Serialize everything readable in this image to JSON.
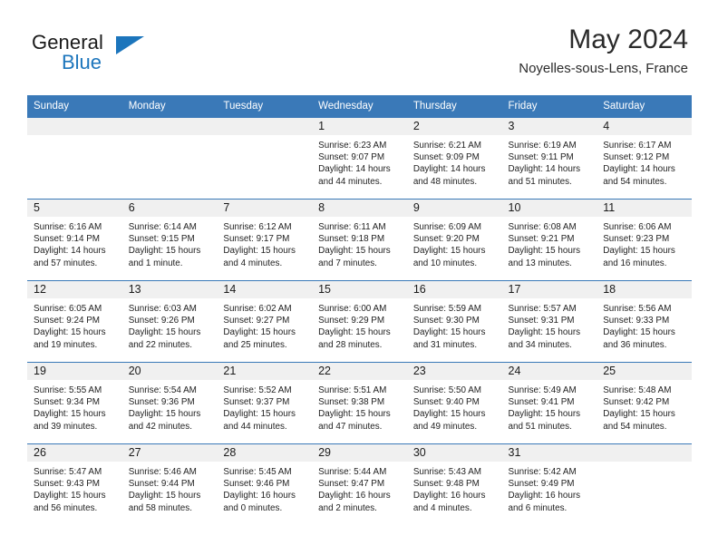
{
  "brand": {
    "name_part1": "General",
    "name_part2": "Blue",
    "logo_icon": "triangle-logo-icon",
    "accent_color": "#1c75bc"
  },
  "header": {
    "month_title": "May 2024",
    "location": "Noyelles-sous-Lens, France"
  },
  "theme": {
    "header_row_color": "#3a79b8",
    "day_band_color": "#f0f0f0",
    "text_color": "#222222"
  },
  "calendar": {
    "weekday_headers": [
      "Sunday",
      "Monday",
      "Tuesday",
      "Wednesday",
      "Thursday",
      "Friday",
      "Saturday"
    ],
    "labels": {
      "sunrise": "Sunrise:",
      "sunset": "Sunset:",
      "daylight": "Daylight:"
    },
    "weeks": [
      [
        {
          "day": "",
          "empty": true
        },
        {
          "day": "",
          "empty": true
        },
        {
          "day": "",
          "empty": true
        },
        {
          "day": "1",
          "sunrise": "Sunrise: 6:23 AM",
          "sunset": "Sunset: 9:07 PM",
          "daylight_line1": "Daylight: 14 hours",
          "daylight_line2": "and 44 minutes."
        },
        {
          "day": "2",
          "sunrise": "Sunrise: 6:21 AM",
          "sunset": "Sunset: 9:09 PM",
          "daylight_line1": "Daylight: 14 hours",
          "daylight_line2": "and 48 minutes."
        },
        {
          "day": "3",
          "sunrise": "Sunrise: 6:19 AM",
          "sunset": "Sunset: 9:11 PM",
          "daylight_line1": "Daylight: 14 hours",
          "daylight_line2": "and 51 minutes."
        },
        {
          "day": "4",
          "sunrise": "Sunrise: 6:17 AM",
          "sunset": "Sunset: 9:12 PM",
          "daylight_line1": "Daylight: 14 hours",
          "daylight_line2": "and 54 minutes."
        }
      ],
      [
        {
          "day": "5",
          "sunrise": "Sunrise: 6:16 AM",
          "sunset": "Sunset: 9:14 PM",
          "daylight_line1": "Daylight: 14 hours",
          "daylight_line2": "and 57 minutes."
        },
        {
          "day": "6",
          "sunrise": "Sunrise: 6:14 AM",
          "sunset": "Sunset: 9:15 PM",
          "daylight_line1": "Daylight: 15 hours",
          "daylight_line2": "and 1 minute."
        },
        {
          "day": "7",
          "sunrise": "Sunrise: 6:12 AM",
          "sunset": "Sunset: 9:17 PM",
          "daylight_line1": "Daylight: 15 hours",
          "daylight_line2": "and 4 minutes."
        },
        {
          "day": "8",
          "sunrise": "Sunrise: 6:11 AM",
          "sunset": "Sunset: 9:18 PM",
          "daylight_line1": "Daylight: 15 hours",
          "daylight_line2": "and 7 minutes."
        },
        {
          "day": "9",
          "sunrise": "Sunrise: 6:09 AM",
          "sunset": "Sunset: 9:20 PM",
          "daylight_line1": "Daylight: 15 hours",
          "daylight_line2": "and 10 minutes."
        },
        {
          "day": "10",
          "sunrise": "Sunrise: 6:08 AM",
          "sunset": "Sunset: 9:21 PM",
          "daylight_line1": "Daylight: 15 hours",
          "daylight_line2": "and 13 minutes."
        },
        {
          "day": "11",
          "sunrise": "Sunrise: 6:06 AM",
          "sunset": "Sunset: 9:23 PM",
          "daylight_line1": "Daylight: 15 hours",
          "daylight_line2": "and 16 minutes."
        }
      ],
      [
        {
          "day": "12",
          "sunrise": "Sunrise: 6:05 AM",
          "sunset": "Sunset: 9:24 PM",
          "daylight_line1": "Daylight: 15 hours",
          "daylight_line2": "and 19 minutes."
        },
        {
          "day": "13",
          "sunrise": "Sunrise: 6:03 AM",
          "sunset": "Sunset: 9:26 PM",
          "daylight_line1": "Daylight: 15 hours",
          "daylight_line2": "and 22 minutes."
        },
        {
          "day": "14",
          "sunrise": "Sunrise: 6:02 AM",
          "sunset": "Sunset: 9:27 PM",
          "daylight_line1": "Daylight: 15 hours",
          "daylight_line2": "and 25 minutes."
        },
        {
          "day": "15",
          "sunrise": "Sunrise: 6:00 AM",
          "sunset": "Sunset: 9:29 PM",
          "daylight_line1": "Daylight: 15 hours",
          "daylight_line2": "and 28 minutes."
        },
        {
          "day": "16",
          "sunrise": "Sunrise: 5:59 AM",
          "sunset": "Sunset: 9:30 PM",
          "daylight_line1": "Daylight: 15 hours",
          "daylight_line2": "and 31 minutes."
        },
        {
          "day": "17",
          "sunrise": "Sunrise: 5:57 AM",
          "sunset": "Sunset: 9:31 PM",
          "daylight_line1": "Daylight: 15 hours",
          "daylight_line2": "and 34 minutes."
        },
        {
          "day": "18",
          "sunrise": "Sunrise: 5:56 AM",
          "sunset": "Sunset: 9:33 PM",
          "daylight_line1": "Daylight: 15 hours",
          "daylight_line2": "and 36 minutes."
        }
      ],
      [
        {
          "day": "19",
          "sunrise": "Sunrise: 5:55 AM",
          "sunset": "Sunset: 9:34 PM",
          "daylight_line1": "Daylight: 15 hours",
          "daylight_line2": "and 39 minutes."
        },
        {
          "day": "20",
          "sunrise": "Sunrise: 5:54 AM",
          "sunset": "Sunset: 9:36 PM",
          "daylight_line1": "Daylight: 15 hours",
          "daylight_line2": "and 42 minutes."
        },
        {
          "day": "21",
          "sunrise": "Sunrise: 5:52 AM",
          "sunset": "Sunset: 9:37 PM",
          "daylight_line1": "Daylight: 15 hours",
          "daylight_line2": "and 44 minutes."
        },
        {
          "day": "22",
          "sunrise": "Sunrise: 5:51 AM",
          "sunset": "Sunset: 9:38 PM",
          "daylight_line1": "Daylight: 15 hours",
          "daylight_line2": "and 47 minutes."
        },
        {
          "day": "23",
          "sunrise": "Sunrise: 5:50 AM",
          "sunset": "Sunset: 9:40 PM",
          "daylight_line1": "Daylight: 15 hours",
          "daylight_line2": "and 49 minutes."
        },
        {
          "day": "24",
          "sunrise": "Sunrise: 5:49 AM",
          "sunset": "Sunset: 9:41 PM",
          "daylight_line1": "Daylight: 15 hours",
          "daylight_line2": "and 51 minutes."
        },
        {
          "day": "25",
          "sunrise": "Sunrise: 5:48 AM",
          "sunset": "Sunset: 9:42 PM",
          "daylight_line1": "Daylight: 15 hours",
          "daylight_line2": "and 54 minutes."
        }
      ],
      [
        {
          "day": "26",
          "sunrise": "Sunrise: 5:47 AM",
          "sunset": "Sunset: 9:43 PM",
          "daylight_line1": "Daylight: 15 hours",
          "daylight_line2": "and 56 minutes."
        },
        {
          "day": "27",
          "sunrise": "Sunrise: 5:46 AM",
          "sunset": "Sunset: 9:44 PM",
          "daylight_line1": "Daylight: 15 hours",
          "daylight_line2": "and 58 minutes."
        },
        {
          "day": "28",
          "sunrise": "Sunrise: 5:45 AM",
          "sunset": "Sunset: 9:46 PM",
          "daylight_line1": "Daylight: 16 hours",
          "daylight_line2": "and 0 minutes."
        },
        {
          "day": "29",
          "sunrise": "Sunrise: 5:44 AM",
          "sunset": "Sunset: 9:47 PM",
          "daylight_line1": "Daylight: 16 hours",
          "daylight_line2": "and 2 minutes."
        },
        {
          "day": "30",
          "sunrise": "Sunrise: 5:43 AM",
          "sunset": "Sunset: 9:48 PM",
          "daylight_line1": "Daylight: 16 hours",
          "daylight_line2": "and 4 minutes."
        },
        {
          "day": "31",
          "sunrise": "Sunrise: 5:42 AM",
          "sunset": "Sunset: 9:49 PM",
          "daylight_line1": "Daylight: 16 hours",
          "daylight_line2": "and 6 minutes."
        },
        {
          "day": "",
          "empty": true
        }
      ]
    ]
  }
}
